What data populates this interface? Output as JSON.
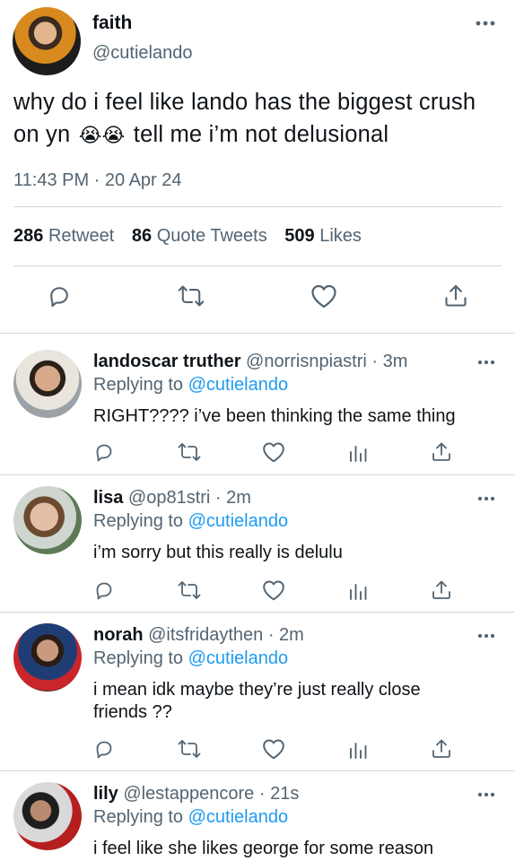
{
  "tweet": {
    "author_name": "faith",
    "author_handle": "@cutielando",
    "text": "why do i feel like lando has the biggest crush on yn",
    "emoji": "😭😭",
    "text_end": "tell me i’m not delusional",
    "timestamp": "11:43 PM · 20 Apr 24",
    "stats": {
      "retweets": "286",
      "retweets_label": "Retweet",
      "quotes": "86",
      "quotes_label": "Quote Tweets",
      "likes": "509",
      "likes_label": "Likes"
    }
  },
  "replies": [
    {
      "name": "landoscar truther",
      "handle_time": "@norrisnpiastri · 3m",
      "replying_prefix": "Replying to",
      "replying_to": "@cutielando",
      "text": "RIGHT???? i’ve been thinking the same thing"
    },
    {
      "name": "lisa",
      "handle_time": "@op81stri · 2m",
      "replying_prefix": "Replying to",
      "replying_to": "@cutielando",
      "text": "i’m sorry but this really is delulu"
    },
    {
      "name": "norah",
      "handle_time": "@itsfridaythen · 2m",
      "replying_prefix": "Replying to",
      "replying_to": "@cutielando",
      "text": "i mean idk maybe they’re just really close friends ??"
    },
    {
      "name": "lily",
      "handle_time": "@lestappencore · 21s",
      "replying_prefix": "Replying to",
      "replying_to": "@cutielando",
      "text": "i feel like she likes george for some reason"
    }
  ],
  "icons": {
    "reply": "reply-icon",
    "retweet": "retweet-icon",
    "like": "heart-icon",
    "share": "share-icon",
    "analytics": "analytics-icon",
    "more": "more-icon"
  },
  "colors": {
    "text": "#0f1419",
    "secondary": "#536471",
    "link": "#1d9bf0",
    "divider": "#cfd9de"
  }
}
